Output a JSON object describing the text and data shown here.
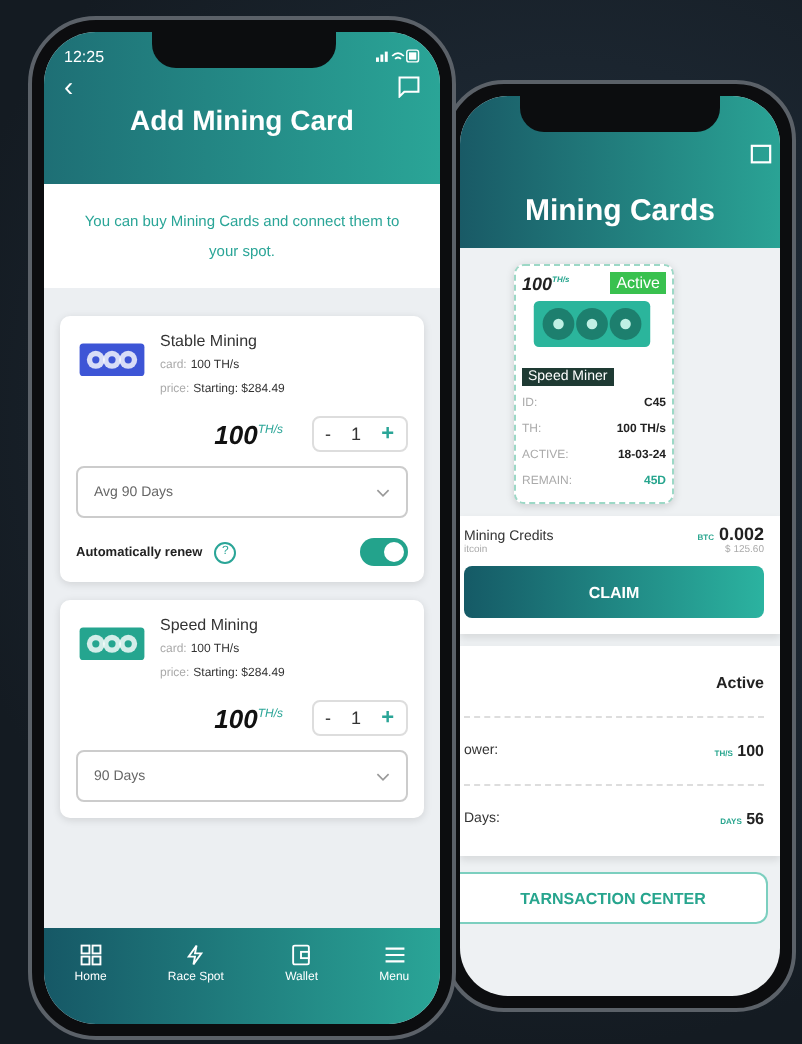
{
  "add_mining_card_screen": {
    "status_bar": {
      "time": "12:25"
    },
    "back": "‹",
    "title": "Add Mining Card",
    "intro": "You can buy Mining Cards and connect them to your spot.",
    "cards": [
      {
        "name": "Stable Mining",
        "color": "#3d55d6",
        "card_label": "card:",
        "card_value": "100 TH/s",
        "price_label": "price:",
        "price_value": "Starting: $284.49",
        "hashrate": "100",
        "unit": "TH/s",
        "minus": "-",
        "quantity": "1",
        "plus": "+",
        "period": "Avg 90 Days",
        "auto_renew": {
          "label": "Automatically renew",
          "help": "?",
          "on": true
        }
      },
      {
        "name": "Speed Mining",
        "color": "#25a58f",
        "card_label": "card:",
        "card_value": "100 TH/s",
        "price_label": "price:",
        "price_value": "Starting: $284.49",
        "hashrate": "100",
        "unit": "TH/s",
        "minus": "-",
        "quantity": "1",
        "plus": "+",
        "period": "90 Days"
      }
    ],
    "nav": [
      {
        "label": "Home",
        "kind": "grid"
      },
      {
        "label": "Race Spot",
        "kind": "bolt"
      },
      {
        "label": "Wallet",
        "kind": "wallet"
      },
      {
        "label": "Menu",
        "kind": "menu"
      }
    ]
  },
  "mining_cards_screen": {
    "title": "Mining Cards",
    "card": {
      "hashrate": "100",
      "unit": "TH/s",
      "status": "Active",
      "name": "Speed Miner",
      "fields": [
        {
          "label": "ID:",
          "value": "C45",
          "accent": false
        },
        {
          "label": "TH:",
          "value": "100 TH/s",
          "accent": false
        },
        {
          "label": "ACTIVE:",
          "value": "18-03-24",
          "accent": false
        },
        {
          "label": "REMAIN:",
          "value": "45D",
          "accent": true
        }
      ]
    },
    "credits": {
      "label": "Mining Credits",
      "sub": "itcoin",
      "unit": "BTC",
      "amount": "0.002",
      "fiat": "$ 125.60"
    },
    "claim": "CLAIM",
    "details": [
      {
        "value": "Active"
      },
      {
        "label": "ower:",
        "unit": "TH/S",
        "value": "100"
      },
      {
        "label": "Days:",
        "unit": "DAYS",
        "value": "56"
      }
    ],
    "transaction_button": "TARNSACTION CENTER"
  }
}
